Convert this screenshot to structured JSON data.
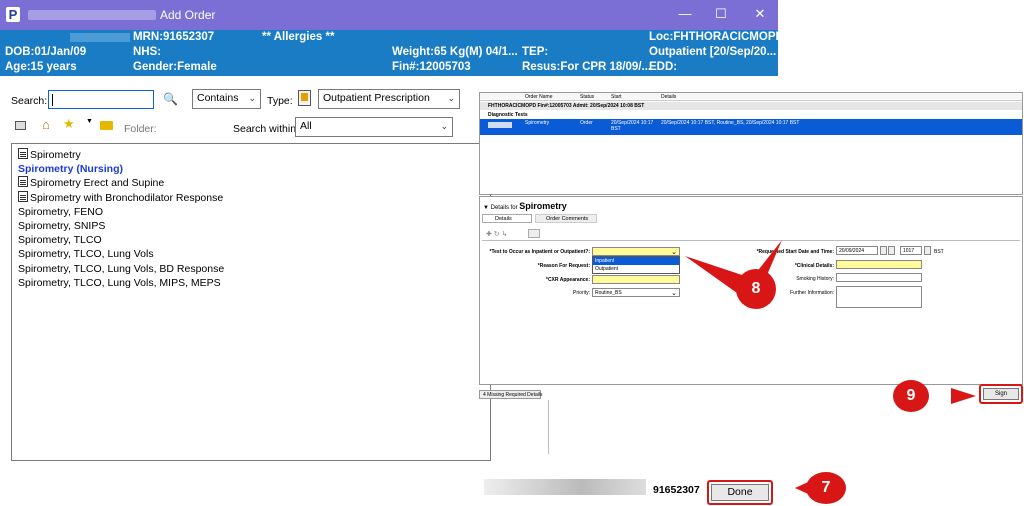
{
  "window": {
    "title": "Add Order",
    "app_logo": "P",
    "min": "—",
    "max": "☐",
    "close": "✕"
  },
  "patient": {
    "mrn": "MRN:91652307",
    "allergies": "** Allergies **",
    "loc": "Loc:FHTHORACICMOPD",
    "dob": "DOB:01/Jan/09",
    "nhs": "NHS:",
    "weight": "Weight:65 Kg(M) 04/1...",
    "tep": "TEP:",
    "outpatient": "Outpatient [20/Sep/20...",
    "age": "Age:15 years",
    "gender": "Gender:Female",
    "fin": "Fin#:12005703",
    "resus": "Resus:For CPR  18/09/...",
    "edd": "EDD:"
  },
  "search": {
    "label": "Search:",
    "value": "",
    "mode": "Contains",
    "type_label": "Type:",
    "type_value": "Outpatient Prescription",
    "folder_label": "Folder:",
    "within_label": "Search within:",
    "within_value": "All"
  },
  "results": [
    {
      "text": "Spirometry",
      "icon": "document-icon",
      "style": "normal"
    },
    {
      "text": "Spirometry (Nursing)",
      "icon": "",
      "style": "bold"
    },
    {
      "text": "Spirometry Erect and Supine",
      "icon": "document-icon",
      "style": "normal"
    },
    {
      "text": "Spirometry with Bronchodilator Response",
      "icon": "document-icon",
      "style": "normal"
    },
    {
      "text": "Spirometry, FENO",
      "icon": "",
      "style": "normal"
    },
    {
      "text": "Spirometry, SNIPS",
      "icon": "",
      "style": "normal"
    },
    {
      "text": "Spirometry, TLCO",
      "icon": "",
      "style": "normal"
    },
    {
      "text": "Spirometry, TLCO, Lung Vols",
      "icon": "",
      "style": "normal"
    },
    {
      "text": "Spirometry, TLCO, Lung Vols, BD Response",
      "icon": "",
      "style": "normal"
    },
    {
      "text": "Spirometry, TLCO, Lung Vols, MIPS, MEPS",
      "icon": "",
      "style": "normal"
    }
  ],
  "order_grid": {
    "headers": [
      "Order Name",
      "Status",
      "Start",
      "Details"
    ],
    "encounter": "FHTHORACICMOPD  Fin#:12005703  Admit: 20/Sep/2024 10:08 BST",
    "section": "Diagnostic Tests",
    "row": {
      "name": "Spirometry",
      "status": "Order",
      "start": "20/Sep/2024 10:17 BST",
      "details": "20/Sep/2024 10:17 BST, Routine_BS, 20/Sep/2024 10:17 BST"
    }
  },
  "details": {
    "header_prefix": "Details for",
    "header_name": "Spirometry",
    "tab_details": "Details",
    "tab_comments": "Order Comments",
    "f_inpatient": "*Test to Occur as Inpatient or Outpatient?:",
    "opt_inpatient": "Inpatient",
    "opt_outpatient": "Outpatient",
    "f_reason": "*Reason For Request:",
    "f_cxr": "*CXR Appearance:",
    "f_priority": "Priority:",
    "priority_value": "Routine_BS",
    "f_start": "*Requested Start Date and Time:",
    "start_date": "20/09/2024",
    "start_time": "1017",
    "tz": "BST",
    "f_clinical": "*Clinical Details:",
    "f_smoking": "Smoking History:",
    "f_further": "Further Information:"
  },
  "footer": {
    "missing": "4 Missing Required Details",
    "sign": "Sign",
    "mrn": "91652307",
    "done": "Done"
  },
  "badges": {
    "b7": "7",
    "b8": "8",
    "b9": "9"
  },
  "colors": {
    "title": "#7b6fd6",
    "banner": "#1a7cc4",
    "annotation": "#d81616",
    "required": "#fffb98",
    "selection": "#0a5bd6"
  }
}
